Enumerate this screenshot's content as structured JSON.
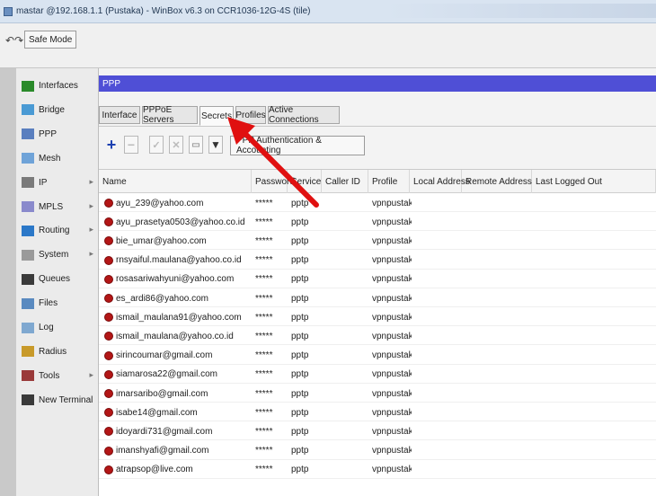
{
  "window_title": "mastar @192.168.1.1 (Pustaka) - WinBox v6.3 on CCR1036-12G-4S (tile)",
  "toolbar_top": {
    "safe_mode_label": "Safe Mode"
  },
  "sidebar": {
    "items": [
      {
        "label": "Interfaces",
        "icon": "interfaces-icon",
        "has_arrow": false
      },
      {
        "label": "Bridge",
        "icon": "bridge-icon",
        "has_arrow": false
      },
      {
        "label": "PPP",
        "icon": "ppp-icon",
        "has_arrow": false
      },
      {
        "label": "Mesh",
        "icon": "mesh-icon",
        "has_arrow": false
      },
      {
        "label": "IP",
        "icon": "ip-icon",
        "has_arrow": true
      },
      {
        "label": "MPLS",
        "icon": "mpls-icon",
        "has_arrow": true
      },
      {
        "label": "Routing",
        "icon": "routing-icon",
        "has_arrow": true
      },
      {
        "label": "System",
        "icon": "system-icon",
        "has_arrow": true
      },
      {
        "label": "Queues",
        "icon": "queues-icon",
        "has_arrow": false
      },
      {
        "label": "Files",
        "icon": "files-icon",
        "has_arrow": false
      },
      {
        "label": "Log",
        "icon": "log-icon",
        "has_arrow": false
      },
      {
        "label": "Radius",
        "icon": "radius-icon",
        "has_arrow": false
      },
      {
        "label": "Tools",
        "icon": "tools-icon",
        "has_arrow": true
      },
      {
        "label": "New Terminal",
        "icon": "terminal-icon",
        "has_arrow": false
      }
    ]
  },
  "ppp_window": {
    "title": "PPP",
    "tabs": [
      {
        "label": "Interface",
        "active": false
      },
      {
        "label": "PPPoE Servers",
        "active": false
      },
      {
        "label": "Secrets",
        "active": true
      },
      {
        "label": "Profiles",
        "active": false
      },
      {
        "label": "Active Connections",
        "active": false
      }
    ],
    "aaa_button_label": "PPP Authentication & Accounting",
    "columns": [
      "Name",
      "Password",
      "Service",
      "Caller ID",
      "Profile",
      "Local Address",
      "Remote Address",
      "Last Logged Out"
    ],
    "rows": [
      {
        "name": "ayu_239@yahoo.com",
        "password": "*****",
        "service": "pptp",
        "profile": "vpnpustaka"
      },
      {
        "name": "ayu_prasetya0503@yahoo.co.id",
        "password": "*****",
        "service": "pptp",
        "profile": "vpnpustaka"
      },
      {
        "name": "bie_umar@yahoo.com",
        "password": "*****",
        "service": "pptp",
        "profile": "vpnpustaka"
      },
      {
        "name": "rnsyaiful.maulana@yahoo.co.id",
        "password": "*****",
        "service": "pptp",
        "profile": "vpnpustaka"
      },
      {
        "name": "rosasariwahyuni@yahoo.com",
        "password": "*****",
        "service": "pptp",
        "profile": "vpnpustaka"
      },
      {
        "name": "es_ardi86@yahoo.com",
        "password": "*****",
        "service": "pptp",
        "profile": "vpnpustaka"
      },
      {
        "name": "ismail_maulana91@yahoo.com",
        "password": "*****",
        "service": "pptp",
        "profile": "vpnpustaka"
      },
      {
        "name": "ismail_maulana@yahoo.co.id",
        "password": "*****",
        "service": "pptp",
        "profile": "vpnpustaka"
      },
      {
        "name": "sirincoumar@gmail.com",
        "password": "*****",
        "service": "pptp",
        "profile": "vpnpustaka"
      },
      {
        "name": "siamarosa22@gmail.com",
        "password": "*****",
        "service": "pptp",
        "profile": "vpnpustaka"
      },
      {
        "name": "imarsaribo@gmail.com",
        "password": "*****",
        "service": "pptp",
        "profile": "vpnpustaka"
      },
      {
        "name": "isabe14@gmail.com",
        "password": "*****",
        "service": "pptp",
        "profile": "vpnpustaka"
      },
      {
        "name": "idoyardi731@gmail.com",
        "password": "*****",
        "service": "pptp",
        "profile": "vpnpustaka"
      },
      {
        "name": "imanshyafi@gmail.com",
        "password": "*****",
        "service": "pptp",
        "profile": "vpnpustaka"
      },
      {
        "name": "atrapsop@live.com",
        "password": "*****",
        "service": "pptp",
        "profile": "vpnpustaka"
      }
    ]
  },
  "colors": {
    "window_title_bar": "#4f4fd6",
    "annotation_arrow": "#e01010",
    "user_icon": "#b31616"
  }
}
